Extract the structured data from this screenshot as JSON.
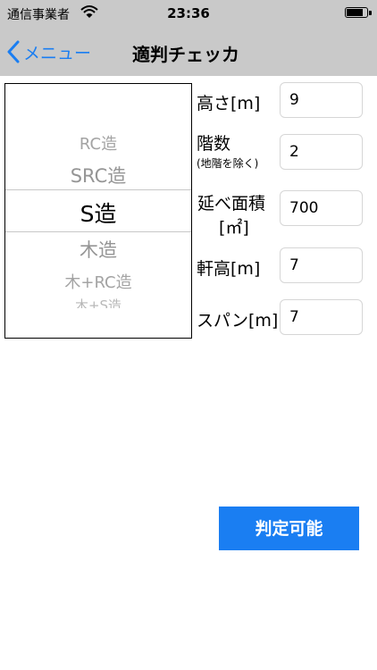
{
  "status_bar": {
    "carrier": "通信事業者",
    "time": "23:36",
    "battery_level": 0.85
  },
  "nav": {
    "back_label": "メニュー",
    "title": "適判チェッカ"
  },
  "picker": {
    "options": [
      "RC造",
      "SRC造",
      "S造",
      "木造",
      "木+RC造",
      "木+S造"
    ],
    "selected": "S造"
  },
  "fields": {
    "height": {
      "label": "高さ[m]",
      "value": "9"
    },
    "floors": {
      "label": "階数",
      "sub_label": "(地階を除く)",
      "value": "2"
    },
    "area": {
      "label_line1": "延べ面積",
      "label_line2": "[㎡]",
      "value": "700"
    },
    "eaves": {
      "label": "軒高[m]",
      "value": "7"
    },
    "span": {
      "label": "スパン[m]",
      "value": "7"
    }
  },
  "action_button": {
    "label": "判定可能"
  },
  "colors": {
    "accent": "#1a7ef2",
    "bar_bg": "#c9c9c9"
  }
}
